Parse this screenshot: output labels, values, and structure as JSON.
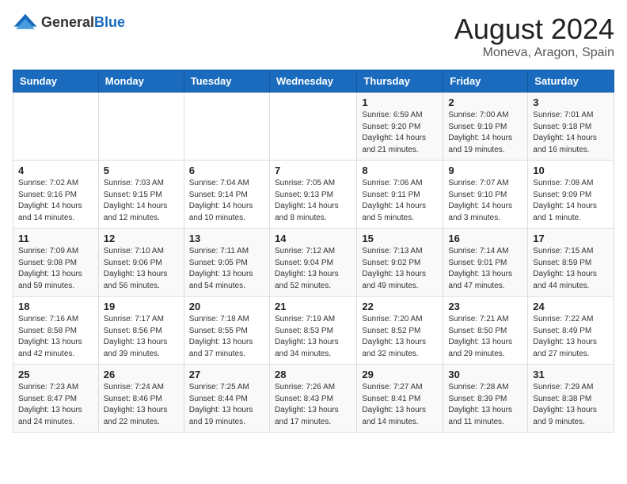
{
  "header": {
    "logo_general": "General",
    "logo_blue": "Blue",
    "month_year": "August 2024",
    "location": "Moneva, Aragon, Spain"
  },
  "days_of_week": [
    "Sunday",
    "Monday",
    "Tuesday",
    "Wednesday",
    "Thursday",
    "Friday",
    "Saturday"
  ],
  "weeks": [
    [
      {
        "day": "",
        "info": ""
      },
      {
        "day": "",
        "info": ""
      },
      {
        "day": "",
        "info": ""
      },
      {
        "day": "",
        "info": ""
      },
      {
        "day": "1",
        "info": "Sunrise: 6:59 AM\nSunset: 9:20 PM\nDaylight: 14 hours\nand 21 minutes."
      },
      {
        "day": "2",
        "info": "Sunrise: 7:00 AM\nSunset: 9:19 PM\nDaylight: 14 hours\nand 19 minutes."
      },
      {
        "day": "3",
        "info": "Sunrise: 7:01 AM\nSunset: 9:18 PM\nDaylight: 14 hours\nand 16 minutes."
      }
    ],
    [
      {
        "day": "4",
        "info": "Sunrise: 7:02 AM\nSunset: 9:16 PM\nDaylight: 14 hours\nand 14 minutes."
      },
      {
        "day": "5",
        "info": "Sunrise: 7:03 AM\nSunset: 9:15 PM\nDaylight: 14 hours\nand 12 minutes."
      },
      {
        "day": "6",
        "info": "Sunrise: 7:04 AM\nSunset: 9:14 PM\nDaylight: 14 hours\nand 10 minutes."
      },
      {
        "day": "7",
        "info": "Sunrise: 7:05 AM\nSunset: 9:13 PM\nDaylight: 14 hours\nand 8 minutes."
      },
      {
        "day": "8",
        "info": "Sunrise: 7:06 AM\nSunset: 9:11 PM\nDaylight: 14 hours\nand 5 minutes."
      },
      {
        "day": "9",
        "info": "Sunrise: 7:07 AM\nSunset: 9:10 PM\nDaylight: 14 hours\nand 3 minutes."
      },
      {
        "day": "10",
        "info": "Sunrise: 7:08 AM\nSunset: 9:09 PM\nDaylight: 14 hours\nand 1 minute."
      }
    ],
    [
      {
        "day": "11",
        "info": "Sunrise: 7:09 AM\nSunset: 9:08 PM\nDaylight: 13 hours\nand 59 minutes."
      },
      {
        "day": "12",
        "info": "Sunrise: 7:10 AM\nSunset: 9:06 PM\nDaylight: 13 hours\nand 56 minutes."
      },
      {
        "day": "13",
        "info": "Sunrise: 7:11 AM\nSunset: 9:05 PM\nDaylight: 13 hours\nand 54 minutes."
      },
      {
        "day": "14",
        "info": "Sunrise: 7:12 AM\nSunset: 9:04 PM\nDaylight: 13 hours\nand 52 minutes."
      },
      {
        "day": "15",
        "info": "Sunrise: 7:13 AM\nSunset: 9:02 PM\nDaylight: 13 hours\nand 49 minutes."
      },
      {
        "day": "16",
        "info": "Sunrise: 7:14 AM\nSunset: 9:01 PM\nDaylight: 13 hours\nand 47 minutes."
      },
      {
        "day": "17",
        "info": "Sunrise: 7:15 AM\nSunset: 8:59 PM\nDaylight: 13 hours\nand 44 minutes."
      }
    ],
    [
      {
        "day": "18",
        "info": "Sunrise: 7:16 AM\nSunset: 8:58 PM\nDaylight: 13 hours\nand 42 minutes."
      },
      {
        "day": "19",
        "info": "Sunrise: 7:17 AM\nSunset: 8:56 PM\nDaylight: 13 hours\nand 39 minutes."
      },
      {
        "day": "20",
        "info": "Sunrise: 7:18 AM\nSunset: 8:55 PM\nDaylight: 13 hours\nand 37 minutes."
      },
      {
        "day": "21",
        "info": "Sunrise: 7:19 AM\nSunset: 8:53 PM\nDaylight: 13 hours\nand 34 minutes."
      },
      {
        "day": "22",
        "info": "Sunrise: 7:20 AM\nSunset: 8:52 PM\nDaylight: 13 hours\nand 32 minutes."
      },
      {
        "day": "23",
        "info": "Sunrise: 7:21 AM\nSunset: 8:50 PM\nDaylight: 13 hours\nand 29 minutes."
      },
      {
        "day": "24",
        "info": "Sunrise: 7:22 AM\nSunset: 8:49 PM\nDaylight: 13 hours\nand 27 minutes."
      }
    ],
    [
      {
        "day": "25",
        "info": "Sunrise: 7:23 AM\nSunset: 8:47 PM\nDaylight: 13 hours\nand 24 minutes."
      },
      {
        "day": "26",
        "info": "Sunrise: 7:24 AM\nSunset: 8:46 PM\nDaylight: 13 hours\nand 22 minutes."
      },
      {
        "day": "27",
        "info": "Sunrise: 7:25 AM\nSunset: 8:44 PM\nDaylight: 13 hours\nand 19 minutes."
      },
      {
        "day": "28",
        "info": "Sunrise: 7:26 AM\nSunset: 8:43 PM\nDaylight: 13 hours\nand 17 minutes."
      },
      {
        "day": "29",
        "info": "Sunrise: 7:27 AM\nSunset: 8:41 PM\nDaylight: 13 hours\nand 14 minutes."
      },
      {
        "day": "30",
        "info": "Sunrise: 7:28 AM\nSunset: 8:39 PM\nDaylight: 13 hours\nand 11 minutes."
      },
      {
        "day": "31",
        "info": "Sunrise: 7:29 AM\nSunset: 8:38 PM\nDaylight: 13 hours\nand 9 minutes."
      }
    ]
  ]
}
